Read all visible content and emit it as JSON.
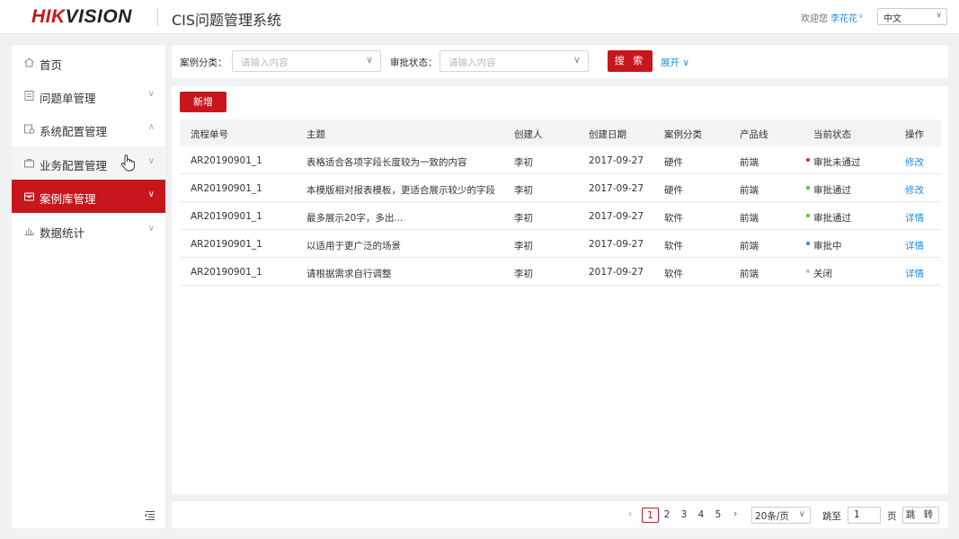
{
  "header": {
    "logo_red": "HIK",
    "logo_dark": "VISION",
    "app_title": "CIS问题管理系统",
    "welcome_text": "欢迎您",
    "user_name": "李花花",
    "language": "中文"
  },
  "sidebar": {
    "items": [
      {
        "label": "首页",
        "icon": "home-icon"
      },
      {
        "label": "问题单管理",
        "icon": "document-icon"
      },
      {
        "label": "系统配置管理",
        "icon": "settings-icon"
      },
      {
        "label": "业务配置管理",
        "icon": "briefcase-icon"
      },
      {
        "label": "案例库管理",
        "icon": "archive-icon"
      },
      {
        "label": "数据统计",
        "icon": "bar-chart-icon"
      }
    ],
    "active_item": "案例库管理"
  },
  "search": {
    "category_label": "案例分类：",
    "category_placeholder": "请输入内容",
    "status_label": "审批状态：",
    "status_placeholder": "请输入内容",
    "search_button": "搜 索",
    "expand_link": "展开"
  },
  "toolbar": {
    "add_button": "新增"
  },
  "table": {
    "columns": [
      "流程单号",
      "主题",
      "创建人",
      "创建日期",
      "案例分类",
      "产品线",
      "当前状态",
      "操作"
    ],
    "rows": [
      {
        "id": "AR20190901_1",
        "subject": "表格适合各项字段长度较为一致的内容",
        "creator": "李初",
        "date": "2017-09-27",
        "category": "硬件",
        "product": "前端",
        "status": "审批未通过",
        "status_color": "#d9262c",
        "action": "修改"
      },
      {
        "id": "AR20190901_1",
        "subject": "本模版相对报表模板，更适合展示较少的字段",
        "creator": "李初",
        "date": "2017-09-27",
        "category": "硬件",
        "product": "前端",
        "status": "审批通过",
        "status_color": "#52c41a",
        "action": "修改"
      },
      {
        "id": "AR20190901_1",
        "subject": "最多展示20字，多出...",
        "creator": "李初",
        "date": "2017-09-27",
        "category": "软件",
        "product": "前端",
        "status": "审批通过",
        "status_color": "#52c41a",
        "action": "详情"
      },
      {
        "id": "AR20190901_1",
        "subject": "以适用于更广泛的场景",
        "creator": "李初",
        "date": "2017-09-27",
        "category": "软件",
        "product": "前端",
        "status": "审批中",
        "status_color": "#1e8ee6",
        "action": "详情"
      },
      {
        "id": "AR20190901_1",
        "subject": "请根据需求自行调整",
        "creator": "李初",
        "date": "2017-09-27",
        "category": "软件",
        "product": "前端",
        "status": "关闭",
        "status_color": "#bfbfbf",
        "action": "详情"
      }
    ]
  },
  "pagination": {
    "pages": [
      "1",
      "2",
      "3",
      "4",
      "5"
    ],
    "current_page": "1",
    "page_size": "20条/页",
    "jump_label": "跳至",
    "jump_value": "1",
    "page_unit": "页",
    "jump_button": "跳 转"
  },
  "colors": {
    "brand": "#c8161d",
    "link": "#1e8ee6"
  }
}
